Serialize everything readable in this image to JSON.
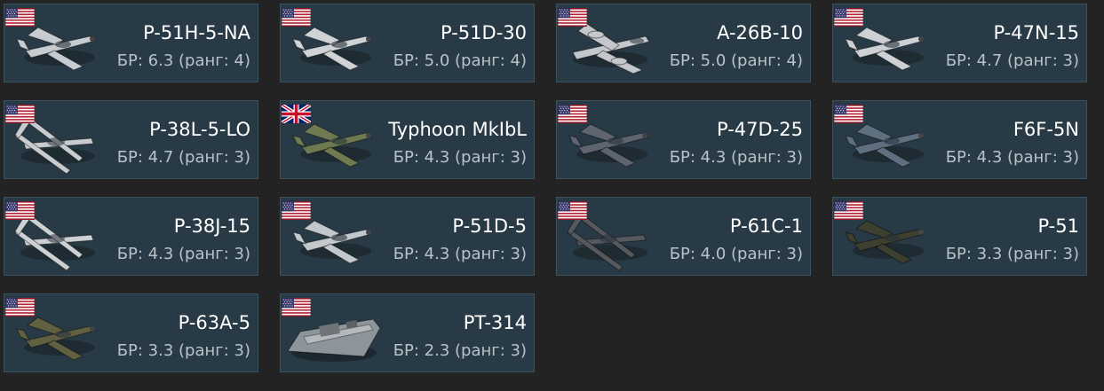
{
  "vehicles": [
    {
      "name": "P-51H-5-NA",
      "br_text": "БР: 6.3 (ранг: 4)",
      "flag": "usa-flag-icon",
      "thumb": "fighter-aircraft-icon",
      "camo": "#c7ccd0"
    },
    {
      "name": "P-51D-30",
      "br_text": "БР: 5.0 (ранг: 4)",
      "flag": "usa-flag-icon",
      "thumb": "fighter-aircraft-icon",
      "camo": "#cfd3d6"
    },
    {
      "name": "A-26B-10",
      "br_text": "БР: 5.0 (ранг: 4)",
      "flag": "usa-flag-icon",
      "thumb": "bomber-aircraft-icon",
      "camo": "#c4c8cc"
    },
    {
      "name": "P-47N-15",
      "br_text": "БР: 4.7 (ранг: 3)",
      "flag": "usa-flag-icon",
      "thumb": "fighter-aircraft-icon",
      "camo": "#cdd1d4"
    },
    {
      "name": "P-38L-5-LO",
      "br_text": "БР: 4.7 (ранг: 3)",
      "flag": "usa-flag-icon",
      "thumb": "twin-boom-aircraft-icon",
      "camo": "#c8ccd0"
    },
    {
      "name": "Typhoon MkIbL",
      "br_text": "БР: 4.3 (ранг: 3)",
      "flag": "uk-flag-icon",
      "thumb": "fighter-aircraft-icon",
      "camo": "#6f7a52"
    },
    {
      "name": "P-47D-25",
      "br_text": "БР: 4.3 (ранг: 3)",
      "flag": "usa-flag-icon",
      "thumb": "fighter-aircraft-icon",
      "camo": "#5f6570"
    },
    {
      "name": "F6F-5N",
      "br_text": "БР: 4.3 (ранг: 3)",
      "flag": "usa-flag-icon",
      "thumb": "fighter-aircraft-icon",
      "camo": "#5e6f80"
    },
    {
      "name": "P-38J-15",
      "br_text": "БР: 4.3 (ранг: 3)",
      "flag": "usa-flag-icon",
      "thumb": "twin-boom-aircraft-icon",
      "camo": "#cdd1d4"
    },
    {
      "name": "P-51D-5",
      "br_text": "БР: 4.3 (ранг: 3)",
      "flag": "usa-flag-icon",
      "thumb": "fighter-aircraft-icon",
      "camo": "#c3c8cc"
    },
    {
      "name": "P-61C-1",
      "br_text": "БР: 4.0 (ранг: 3)",
      "flag": "usa-flag-icon",
      "thumb": "twin-boom-aircraft-icon",
      "camo": "#55595d"
    },
    {
      "name": "P-51",
      "br_text": "БР: 3.3 (ранг: 3)",
      "flag": "usa-flag-icon",
      "thumb": "fighter-aircraft-icon",
      "camo": "#3d3f2f"
    },
    {
      "name": "P-63A-5",
      "br_text": "БР: 3.3 (ранг: 3)",
      "flag": "usa-flag-icon",
      "thumb": "fighter-aircraft-icon",
      "camo": "#5f6141"
    },
    {
      "name": "PT-314",
      "br_text": "БР: 2.3 (ранг: 3)",
      "flag": "usa-flag-icon",
      "thumb": "torpedo-boat-icon",
      "camo": "#8e959a"
    }
  ]
}
